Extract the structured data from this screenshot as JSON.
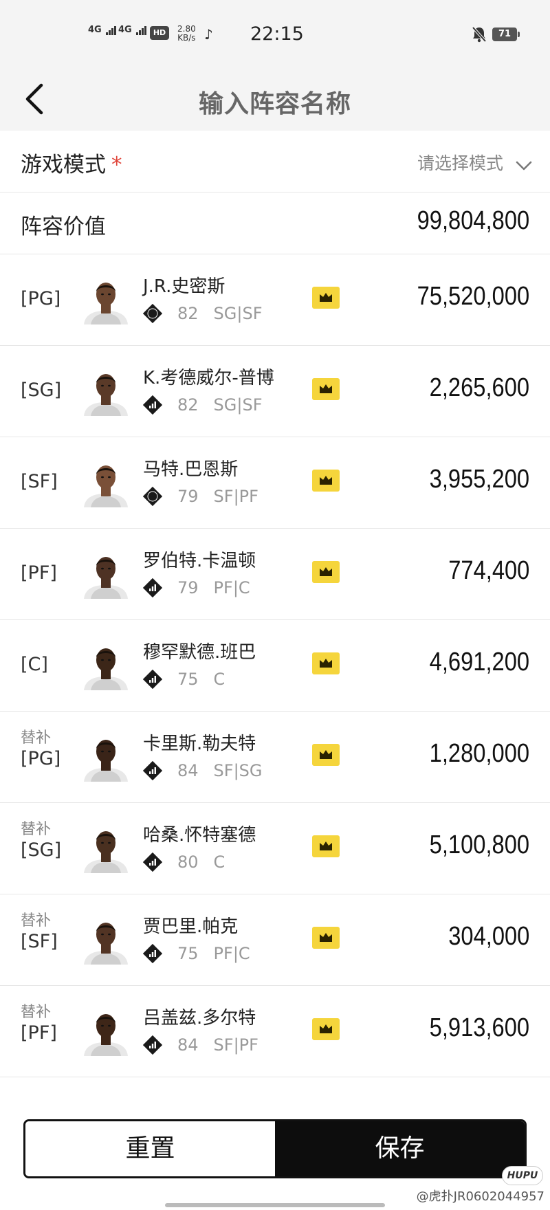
{
  "status_bar": {
    "signal1": "4G",
    "signal2": "4G",
    "hd_badge": "HD",
    "speed_value": "2.80",
    "speed_unit": "KB/s",
    "time": "22:15",
    "battery": "71"
  },
  "nav": {
    "title": "输入阵容名称"
  },
  "mode": {
    "label": "游戏模式",
    "required_mark": "*",
    "placeholder": "请选择模式"
  },
  "lineup_value": {
    "label": "阵容价值",
    "value": "99,804,800"
  },
  "players": [
    {
      "pos": "[PG]",
      "bench": "",
      "name": "J.R.史密斯",
      "badge": "08",
      "rating": "82",
      "positions": "SG|SF",
      "price": "75,520,000",
      "skin": "#6b4630"
    },
    {
      "pos": "[SG]",
      "bench": "",
      "name": "K.考德威尔-普博",
      "badge": "bars",
      "rating": "82",
      "positions": "SG|SF",
      "price": "2,265,600",
      "skin": "#5a3a28"
    },
    {
      "pos": "[SF]",
      "bench": "",
      "name": "马特.巴恩斯",
      "badge": "06",
      "rating": "79",
      "positions": "SF|PF",
      "price": "3,955,200",
      "skin": "#7a5038"
    },
    {
      "pos": "[PF]",
      "bench": "",
      "name": "罗伯特.卡温顿",
      "badge": "bars",
      "rating": "79",
      "positions": "PF|C",
      "price": "774,400",
      "skin": "#4e3224"
    },
    {
      "pos": "[C]",
      "bench": "",
      "name": "穆罕默德.班巴",
      "badge": "bars",
      "rating": "75",
      "positions": "C",
      "price": "4,691,200",
      "skin": "#3c2618"
    },
    {
      "pos": "[PG]",
      "bench": "替补",
      "name": "卡里斯.勒夫特",
      "badge": "bars",
      "rating": "84",
      "positions": "SF|SG",
      "price": "1,280,000",
      "skin": "#3a2418"
    },
    {
      "pos": "[SG]",
      "bench": "替补",
      "name": "哈桑.怀特塞德",
      "badge": "bars",
      "rating": "80",
      "positions": "C",
      "price": "5,100,800",
      "skin": "#4a3020"
    },
    {
      "pos": "[SF]",
      "bench": "替补",
      "name": "贾巴里.帕克",
      "badge": "bars",
      "rating": "75",
      "positions": "PF|C",
      "price": "304,000",
      "skin": "#523424"
    },
    {
      "pos": "[PF]",
      "bench": "替补",
      "name": "吕盖兹.多尔特",
      "badge": "bars",
      "rating": "84",
      "positions": "SF|PF",
      "price": "5,913,600",
      "skin": "#3e2618"
    }
  ],
  "buttons": {
    "reset": "重置",
    "save": "保存"
  },
  "watermark": "@虎扑JR0602044957",
  "watermark_logo": "HUPU",
  "colors": {
    "crown_bg": "#f5d53c",
    "accent_star": "#e0453a",
    "save_bg": "#0d0d0d"
  }
}
